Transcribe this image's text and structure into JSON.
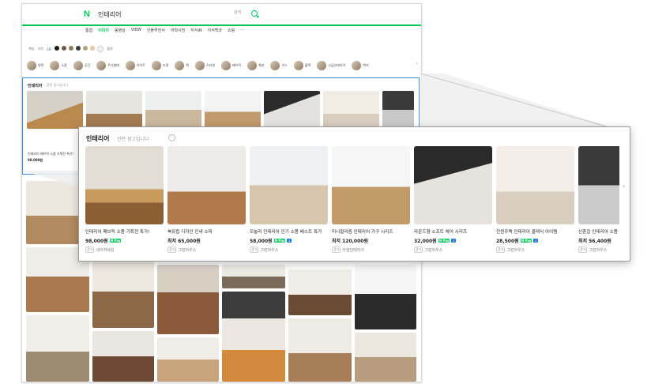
{
  "header": {
    "logo": "N",
    "query": "인테리어",
    "search_hint": "검색"
  },
  "tabs": [
    {
      "label": "통합",
      "active": false
    },
    {
      "label": "이미지",
      "active": true
    },
    {
      "label": "동영상",
      "active": false
    },
    {
      "label": "VIEW",
      "active": false
    },
    {
      "label": "인플루언서",
      "active": false
    },
    {
      "label": "어학사전",
      "active": false
    },
    {
      "label": "지식iN",
      "active": false
    },
    {
      "label": "지식백과",
      "active": false
    },
    {
      "label": "쇼핑",
      "active": false
    },
    {
      "label": "···",
      "active": false
    }
  ],
  "filters": {
    "left": "색상",
    "mid": "크기",
    "right": "GIF",
    "more": "옵션"
  },
  "color_swatches": [
    "#1a1a1a",
    "#6b5a4a",
    "#8a7a60",
    "#3a3a3a",
    "#b7a07a",
    "#e4c9a3",
    "#f2f2f2"
  ],
  "chips": [
    "원목",
    "소품",
    "공간",
    "주거형태",
    "라이트",
    "조명",
    "책",
    "스타일",
    "패브릭",
    "화분",
    "우드",
    "블랙",
    "고급인테리어",
    "벽지"
  ],
  "ad": {
    "title": "인테리어",
    "subtitle": "관련 광고입니다",
    "small_caption": "인테리어 패브릭 소품 기획전 특가!",
    "small_price": "98,000원",
    "cards": [
      {
        "caption": "인테리어 패브릭 소품 기획전 특가!",
        "price": "98,000원",
        "npay": true,
        "dl": false,
        "store": "네이처네임",
        "ad": "광고"
      },
      {
        "caption": "북유럽 디자인 인싸 소파",
        "price": "최저 65,000원",
        "npay": false,
        "dl": false,
        "store": "그린하우스",
        "ad": "광고"
      },
      {
        "caption": "모놀리 인테리어 인기 소품 베스트 특가",
        "price": "58,000원",
        "npay": true,
        "dl": true,
        "store": "그린하우스",
        "ad": "광고"
      },
      {
        "caption": "미니멀리즘 인테리어 가구 시리즈",
        "price": "최저 120,000원",
        "npay": false,
        "dl": false,
        "store": "아임인테리어",
        "ad": "광고"
      },
      {
        "caption": "라운드형 소프트 체어 시리즈",
        "price": "32,000원",
        "npay": true,
        "dl": true,
        "store": "그린하우스",
        "ad": "광고"
      },
      {
        "caption": "전원주택 인테리어 클래식 아이템",
        "price": "28,500원",
        "npay": true,
        "dl": true,
        "store": "그린하우스",
        "ad": "광고"
      },
      {
        "caption": "신혼집 인테리어 소품",
        "price": "최저 56,400원",
        "npay": false,
        "dl": false,
        "store": "그린하우스",
        "ad": "광고"
      }
    ]
  },
  "icons": {
    "search": "search-icon",
    "arrow_right": "chevron-right-icon",
    "info": "info-icon"
  }
}
